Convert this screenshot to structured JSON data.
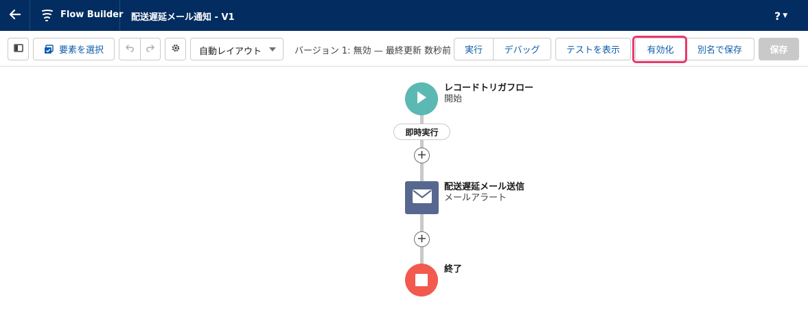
{
  "header": {
    "app_name": "Flow Builder",
    "flow_title": "配送遅延メール通知 - V1",
    "help_label": "?"
  },
  "toolbar": {
    "select_elements_label": "要素を選択",
    "layout_select_value": "自動レイアウト",
    "version_status": "バージョン 1: 無効 — 最終更新 数秒前",
    "run_label": "実行",
    "debug_label": "デバッグ",
    "view_tests_label": "テストを表示",
    "activate_label": "有効化",
    "save_as_label": "別名で保存",
    "save_label": "保存"
  },
  "canvas": {
    "start_node": {
      "title": "レコードトリガフロー",
      "subtitle": "開始"
    },
    "path_label": "即時実行",
    "action_node": {
      "title": "配送遅延メール送信",
      "subtitle": "メールアラート"
    },
    "end_node": {
      "title": "終了"
    }
  },
  "colors": {
    "header_bg": "#032d60",
    "link_blue": "#0b5cab",
    "start_node": "#5cb8b2",
    "action_node": "#58678f",
    "end_node": "#f15a4d",
    "highlight": "#e8386d"
  },
  "icons": {
    "back": "arrow-left-icon",
    "app": "flow-logo-icon",
    "toggle_panel": "panel-toggle-icon",
    "select": "select-elements-icon",
    "undo": "undo-icon",
    "redo": "redo-icon",
    "settings": "gear-icon",
    "start": "play-icon",
    "email": "email-icon",
    "end": "stop-icon",
    "add": "add-circle-icon"
  }
}
